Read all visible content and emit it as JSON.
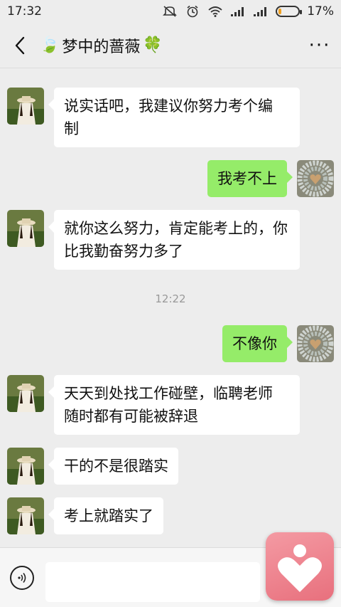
{
  "status_bar": {
    "time": "17:32",
    "battery_percent": "17%",
    "battery_level": 0.17,
    "icons": [
      "mute-icon",
      "alarm-icon",
      "wifi-icon",
      "signal-icon",
      "signal-icon",
      "battery-icon"
    ]
  },
  "header": {
    "title_prefix_emoji": "🍃",
    "title": "梦中的蔷薇",
    "title_suffix_emoji": "🍀",
    "back_icon": "back-chevron-icon",
    "more_icon": "more-dots-icon",
    "more_glyph": "···"
  },
  "messages": [
    {
      "from": "them",
      "text": "说实话吧，我建议你努力考个编\n制"
    },
    {
      "from": "me",
      "text": "我考不上"
    },
    {
      "from": "them",
      "text": "就你这么努力，肯定能考上的，你\n比我勤奋努力多了"
    },
    {
      "type": "time",
      "text": "12:22"
    },
    {
      "from": "me",
      "text": "不像你"
    },
    {
      "from": "them",
      "text": "天天到处找工作碰壁，临聘老师\n随时都有可能被辞退"
    },
    {
      "from": "them",
      "text": "干的不是很踏实"
    },
    {
      "from": "them",
      "text": "考上就踏实了"
    }
  ],
  "input_bar": {
    "voice_icon": "voice-input-icon",
    "input_value": ""
  },
  "floating_app": {
    "icon": "heart-person-icon"
  },
  "colors": {
    "background": "#ededed",
    "incoming": "#ffffff",
    "outgoing": "#95ec69",
    "floating": "#e8707d"
  }
}
